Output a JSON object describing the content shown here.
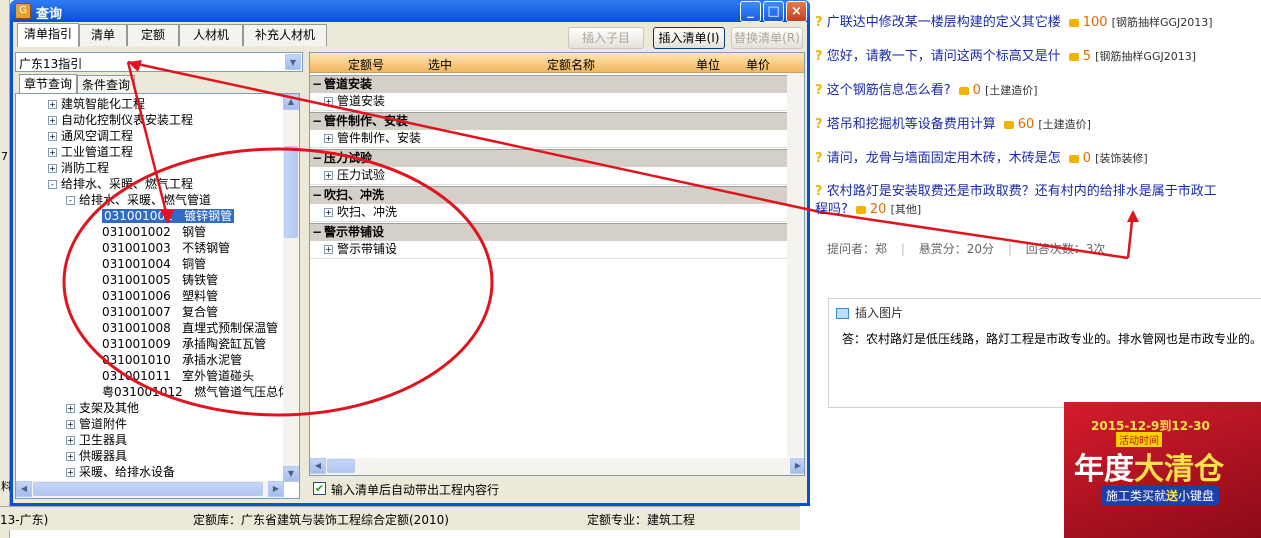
{
  "dialog": {
    "title": "查询",
    "tabs": [
      "清单指引",
      "清单",
      "定额",
      "人材机",
      "补充人材机"
    ],
    "buttons": {
      "insert_child": "插入子目",
      "insert_list": "插入清单(I)",
      "replace_list": "替换清单(R)"
    },
    "guide_combo": "广东13指引",
    "subtabs": [
      "章节查询",
      "条件查询"
    ],
    "tree": [
      {
        "label": "建筑智能化工程",
        "sign": "+",
        "level": 1
      },
      {
        "label": "自动化控制仪表安装工程",
        "sign": "+",
        "level": 1
      },
      {
        "label": "通风空调工程",
        "sign": "+",
        "level": 1
      },
      {
        "label": "工业管道工程",
        "sign": "+",
        "level": 1
      },
      {
        "label": "消防工程",
        "sign": "+",
        "level": 1
      },
      {
        "label": "给排水、采暖、燃气工程",
        "sign": "-",
        "level": 1
      },
      {
        "label": "给排水、采暖、燃气管道",
        "sign": "-",
        "level": 2
      },
      {
        "code": "031001001",
        "label": "镀锌钢管",
        "level": 3,
        "selected": true
      },
      {
        "code": "031001002",
        "label": "钢管",
        "level": 3
      },
      {
        "code": "031001003",
        "label": "不锈钢管",
        "level": 3
      },
      {
        "code": "031001004",
        "label": "铜管",
        "level": 3
      },
      {
        "code": "031001005",
        "label": "铸铁管",
        "level": 3
      },
      {
        "code": "031001006",
        "label": "塑料管",
        "level": 3
      },
      {
        "code": "031001007",
        "label": "复合管",
        "level": 3
      },
      {
        "code": "031001008",
        "label": "直埋式预制保温管",
        "level": 3
      },
      {
        "code": "031001009",
        "label": "承插陶瓷缸瓦管",
        "level": 3
      },
      {
        "code": "031001010",
        "label": "承插水泥管",
        "level": 3
      },
      {
        "code": "031001011",
        "label": "室外管道碰头",
        "level": 3
      },
      {
        "code": "粤031001012",
        "label": "燃气管道气压总体试",
        "level": 3
      },
      {
        "label": "支架及其他",
        "sign": "+",
        "level": 2
      },
      {
        "label": "管道附件",
        "sign": "+",
        "level": 2
      },
      {
        "label": "卫生器具",
        "sign": "+",
        "level": 2
      },
      {
        "label": "供暖器具",
        "sign": "+",
        "level": 2
      },
      {
        "label": "采暖、给排水设备",
        "sign": "+",
        "level": 2
      }
    ],
    "grid_headers": [
      "定额号",
      "选中",
      "定额名称",
      "单位",
      "单价"
    ],
    "grid_sections": [
      {
        "title": "管道安装",
        "items": [
          "管道安装"
        ]
      },
      {
        "title": "管件制作、安装",
        "items": [
          "管件制作、安装"
        ]
      },
      {
        "title": "压力试验",
        "items": [
          "压力试验"
        ]
      },
      {
        "title": "吹扫、冲洗",
        "items": [
          "吹扫、冲洗"
        ]
      },
      {
        "title": "警示带铺设",
        "items": [
          "警示带铺设"
        ]
      }
    ],
    "auto_checkbox_label": "输入清单后自动带出工程内容行"
  },
  "statusbar": {
    "left": "13-广东)",
    "quota_lib": "定额库：广东省建筑与装饰工程综合定额(2010)",
    "quota_major": "定额专业：建筑工程"
  },
  "questions": [
    {
      "text": "广联达中修改某一楼层构建的定义其它楼",
      "points": "100",
      "tag": "[钢筋抽样GGJ2013]"
    },
    {
      "text": "您好，请教一下，请问这两个标高又是什",
      "points": "5",
      "tag": "[钢筋抽样GGJ2013]"
    },
    {
      "text": "这个钢筋信息怎么看?",
      "points": "0",
      "tag": "[土建造价]"
    },
    {
      "text": "塔吊和挖掘机等设备费用计算",
      "points": "60",
      "tag": "[土建造价]"
    },
    {
      "text": "请问，龙骨与墙面固定用木砖，木砖是怎",
      "points": "0",
      "tag": "[装饰装修]"
    },
    {
      "text": "农村路灯是安装取费还是市政取费？还有村内的给排水是属于市政工",
      "text2": "程吗?",
      "points": "20",
      "tag": "[其他]"
    }
  ],
  "meta": {
    "asker": "提问者：郑",
    "reward": "悬赏分：20分",
    "answers": "回答次数：3次"
  },
  "answer": {
    "insert_image": "插入图片",
    "text": "答：农村路灯是低压线路，路灯工程是市政专业的。排水管网也是市政专业的。"
  },
  "ad": {
    "date": "2015-12-9到12-30",
    "activity": "活动时间",
    "headline_a": "年度",
    "headline_b": "大清仓",
    "sub_a": "施工类买就",
    "sub_b": "送",
    "sub_c": "小键盘"
  },
  "colors": {
    "annotation": "#e0141e",
    "link": "#1a2aa8",
    "points": "#e26b00"
  }
}
